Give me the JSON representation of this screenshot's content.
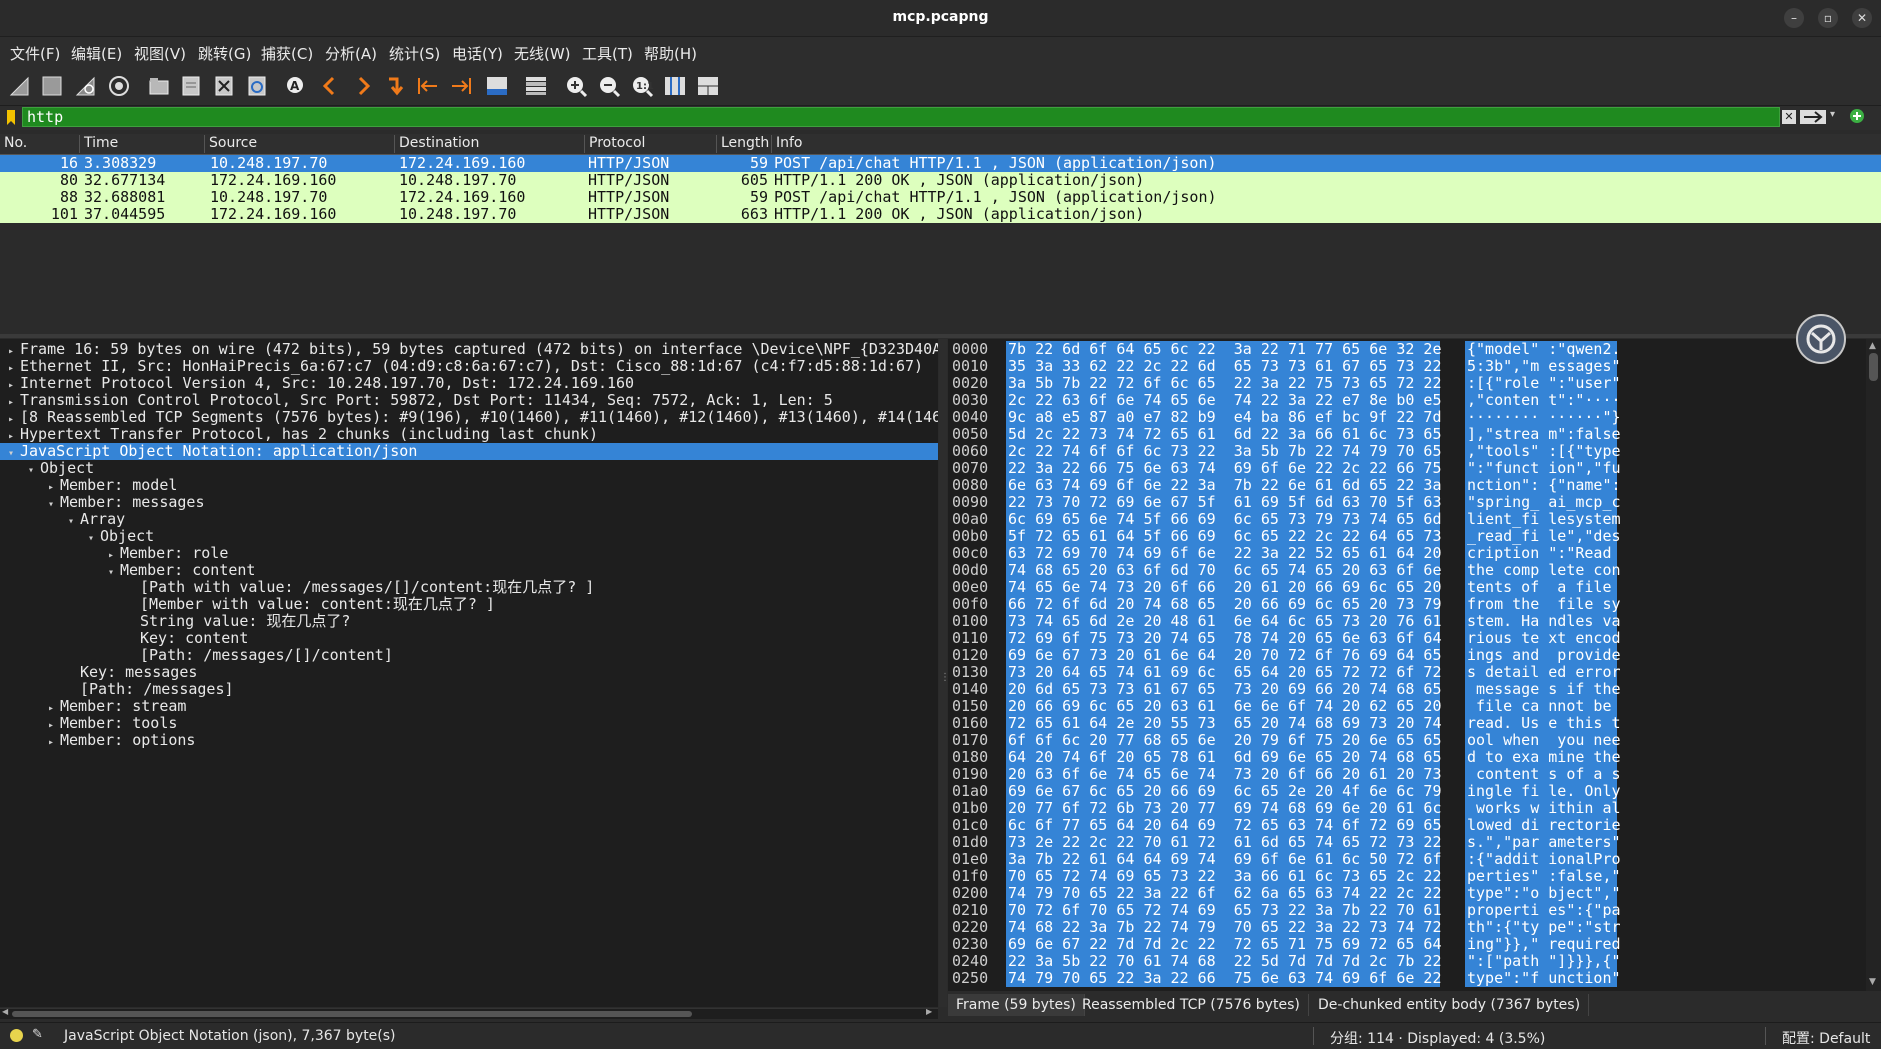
{
  "window": {
    "title": "mcp.pcapng"
  },
  "menu": [
    "文件(F)",
    "编辑(E)",
    "视图(V)",
    "跳转(G)",
    "捕获(C)",
    "分析(A)",
    "统计(S)",
    "电话(Y)",
    "无线(W)",
    "工具(T)",
    "帮助(H)"
  ],
  "filter": {
    "value": "http"
  },
  "columns": [
    "No.",
    "Time",
    "Source",
    "Destination",
    "Protocol",
    "Length",
    "Info"
  ],
  "packets": [
    {
      "no": "16",
      "time": "3.308329",
      "src": "10.248.197.70",
      "dst": "172.24.169.160",
      "proto": "HTTP/JSON",
      "len": "59",
      "info": "POST /api/chat HTTP/1.1 , JSON (application/json)"
    },
    {
      "no": "80",
      "time": "32.677134",
      "src": "172.24.169.160",
      "dst": "10.248.197.70",
      "proto": "HTTP/JSON",
      "len": "605",
      "info": "HTTP/1.1 200 OK , JSON (application/json)"
    },
    {
      "no": "88",
      "time": "32.688081",
      "src": "10.248.197.70",
      "dst": "172.24.169.160",
      "proto": "HTTP/JSON",
      "len": "59",
      "info": "POST /api/chat HTTP/1.1 , JSON (application/json)"
    },
    {
      "no": "101",
      "time": "37.044595",
      "src": "172.24.169.160",
      "dst": "10.248.197.70",
      "proto": "HTTP/JSON",
      "len": "663",
      "info": "HTTP/1.1 200 OK , JSON (application/json)"
    }
  ],
  "details": [
    {
      "indent": 0,
      "arrow": "right",
      "text": "Frame 16: 59 bytes on wire (472 bits), 59 bytes captured (472 bits) on interface \\Device\\NPF_{D323D40A"
    },
    {
      "indent": 0,
      "arrow": "right",
      "text": "Ethernet II, Src: HonHaiPrecis_6a:67:c7 (04:d9:c8:6a:67:c7), Dst: Cisco_88:1d:67 (c4:f7:d5:88:1d:67)"
    },
    {
      "indent": 0,
      "arrow": "right",
      "text": "Internet Protocol Version 4, Src: 10.248.197.70, Dst: 172.24.169.160"
    },
    {
      "indent": 0,
      "arrow": "right",
      "text": "Transmission Control Protocol, Src Port: 59872, Dst Port: 11434, Seq: 7572, Ack: 1, Len: 5"
    },
    {
      "indent": 0,
      "arrow": "right",
      "text": "[8 Reassembled TCP Segments (7576 bytes): #9(196), #10(1460), #11(1460), #12(1460), #13(1460), #14(146"
    },
    {
      "indent": 0,
      "arrow": "right",
      "text": "Hypertext Transfer Protocol, has 2 chunks (including last chunk)"
    },
    {
      "indent": 0,
      "arrow": "down",
      "text": "JavaScript Object Notation: application/json"
    },
    {
      "indent": 1,
      "arrow": "down",
      "text": "Object"
    },
    {
      "indent": 2,
      "arrow": "right",
      "text": "Member: model"
    },
    {
      "indent": 2,
      "arrow": "down",
      "text": "Member: messages"
    },
    {
      "indent": 3,
      "arrow": "down",
      "text": "Array"
    },
    {
      "indent": 4,
      "arrow": "down",
      "text": "Object"
    },
    {
      "indent": 5,
      "arrow": "right",
      "text": "Member: role"
    },
    {
      "indent": 5,
      "arrow": "down",
      "text": "Member: content"
    },
    {
      "indent": 6,
      "arrow": "none",
      "text": "[Path with value: /messages/[]/content:现在几点了? ]"
    },
    {
      "indent": 6,
      "arrow": "none",
      "text": "[Member with value: content:现在几点了? ]"
    },
    {
      "indent": 6,
      "arrow": "none",
      "text": "String value: 现在几点了?"
    },
    {
      "indent": 6,
      "arrow": "none",
      "text": "Key: content"
    },
    {
      "indent": 6,
      "arrow": "none",
      "text": "[Path: /messages/[]/content]"
    },
    {
      "indent": 3,
      "arrow": "none",
      "text": "Key: messages"
    },
    {
      "indent": 3,
      "arrow": "none",
      "text": "[Path: /messages]"
    },
    {
      "indent": 2,
      "arrow": "right",
      "text": "Member: stream"
    },
    {
      "indent": 2,
      "arrow": "right",
      "text": "Member: tools"
    },
    {
      "indent": 2,
      "arrow": "right",
      "text": "Member: options"
    }
  ],
  "bytes": [
    {
      "off": "0000",
      "hex": "7b 22 6d 6f 64 65 6c 22  3a 22 71 77 65 6e 32 2e",
      "ascii": "{\"model\" :\"qwen2."
    },
    {
      "off": "0010",
      "hex": "35 3a 33 62 22 2c 22 6d  65 73 73 61 67 65 73 22",
      "ascii": "5:3b\",\"m essages\""
    },
    {
      "off": "0020",
      "hex": "3a 5b 7b 22 72 6f 6c 65  22 3a 22 75 73 65 72 22",
      "ascii": ":[{\"role \":\"user\""
    },
    {
      "off": "0030",
      "hex": "2c 22 63 6f 6e 74 65 6e  74 22 3a 22 e7 8e b0 e5",
      "ascii": ",\"conten t\":\"····"
    },
    {
      "off": "0040",
      "hex": "9c a8 e5 87 a0 e7 82 b9  e4 ba 86 ef bc 9f 22 7d",
      "ascii": "········ ······\"}"
    },
    {
      "off": "0050",
      "hex": "5d 2c 22 73 74 72 65 61  6d 22 3a 66 61 6c 73 65",
      "ascii": "],\"strea m\":false"
    },
    {
      "off": "0060",
      "hex": "2c 22 74 6f 6f 6c 73 22  3a 5b 7b 22 74 79 70 65",
      "ascii": ",\"tools\" :[{\"type"
    },
    {
      "off": "0070",
      "hex": "22 3a 22 66 75 6e 63 74  69 6f 6e 22 2c 22 66 75",
      "ascii": "\":\"funct ion\",\"fu"
    },
    {
      "off": "0080",
      "hex": "6e 63 74 69 6f 6e 22 3a  7b 22 6e 61 6d 65 22 3a",
      "ascii": "nction\": {\"name\":"
    },
    {
      "off": "0090",
      "hex": "22 73 70 72 69 6e 67 5f  61 69 5f 6d 63 70 5f 63",
      "ascii": "\"spring_ ai_mcp_c"
    },
    {
      "off": "00a0",
      "hex": "6c 69 65 6e 74 5f 66 69  6c 65 73 79 73 74 65 6d",
      "ascii": "lient_fi lesystem"
    },
    {
      "off": "00b0",
      "hex": "5f 72 65 61 64 5f 66 69  6c 65 22 2c 22 64 65 73",
      "ascii": "_read_fi le\",\"des"
    },
    {
      "off": "00c0",
      "hex": "63 72 69 70 74 69 6f 6e  22 3a 22 52 65 61 64 20",
      "ascii": "cription \":\"Read "
    },
    {
      "off": "00d0",
      "hex": "74 68 65 20 63 6f 6d 70  6c 65 74 65 20 63 6f 6e",
      "ascii": "the comp lete con"
    },
    {
      "off": "00e0",
      "hex": "74 65 6e 74 73 20 6f 66  20 61 20 66 69 6c 65 20",
      "ascii": "tents of  a file "
    },
    {
      "off": "00f0",
      "hex": "66 72 6f 6d 20 74 68 65  20 66 69 6c 65 20 73 79",
      "ascii": "from the  file sy"
    },
    {
      "off": "0100",
      "hex": "73 74 65 6d 2e 20 48 61  6e 64 6c 65 73 20 76 61",
      "ascii": "stem. Ha ndles va"
    },
    {
      "off": "0110",
      "hex": "72 69 6f 75 73 20 74 65  78 74 20 65 6e 63 6f 64",
      "ascii": "rious te xt encod"
    },
    {
      "off": "0120",
      "hex": "69 6e 67 73 20 61 6e 64  20 70 72 6f 76 69 64 65",
      "ascii": "ings and  provide"
    },
    {
      "off": "0130",
      "hex": "73 20 64 65 74 61 69 6c  65 64 20 65 72 72 6f 72",
      "ascii": "s detail ed error"
    },
    {
      "off": "0140",
      "hex": "20 6d 65 73 73 61 67 65  73 20 69 66 20 74 68 65",
      "ascii": " message s if the"
    },
    {
      "off": "0150",
      "hex": "20 66 69 6c 65 20 63 61  6e 6e 6f 74 20 62 65 20",
      "ascii": " file ca nnot be "
    },
    {
      "off": "0160",
      "hex": "72 65 61 64 2e 20 55 73  65 20 74 68 69 73 20 74",
      "ascii": "read. Us e this t"
    },
    {
      "off": "0170",
      "hex": "6f 6f 6c 20 77 68 65 6e  20 79 6f 75 20 6e 65 65",
      "ascii": "ool when  you nee"
    },
    {
      "off": "0180",
      "hex": "64 20 74 6f 20 65 78 61  6d 69 6e 65 20 74 68 65",
      "ascii": "d to exa mine the"
    },
    {
      "off": "0190",
      "hex": "20 63 6f 6e 74 65 6e 74  73 20 6f 66 20 61 20 73",
      "ascii": " content s of a s"
    },
    {
      "off": "01a0",
      "hex": "69 6e 67 6c 65 20 66 69  6c 65 2e 20 4f 6e 6c 79",
      "ascii": "ingle fi le. Only"
    },
    {
      "off": "01b0",
      "hex": "20 77 6f 72 6b 73 20 77  69 74 68 69 6e 20 61 6c",
      "ascii": " works w ithin al"
    },
    {
      "off": "01c0",
      "hex": "6c 6f 77 65 64 20 64 69  72 65 63 74 6f 72 69 65",
      "ascii": "lowed di rectorie"
    },
    {
      "off": "01d0",
      "hex": "73 2e 22 2c 22 70 61 72  61 6d 65 74 65 72 73 22",
      "ascii": "s.\",\"par ameters\""
    },
    {
      "off": "01e0",
      "hex": "3a 7b 22 61 64 64 69 74  69 6f 6e 61 6c 50 72 6f",
      "ascii": ":{\"addit ionalPro"
    },
    {
      "off": "01f0",
      "hex": "70 65 72 74 69 65 73 22  3a 66 61 6c 73 65 2c 22",
      "ascii": "perties\" :false,\""
    },
    {
      "off": "0200",
      "hex": "74 79 70 65 22 3a 22 6f  62 6a 65 63 74 22 2c 22",
      "ascii": "type\":\"o bject\",\""
    },
    {
      "off": "0210",
      "hex": "70 72 6f 70 65 72 74 69  65 73 22 3a 7b 22 70 61",
      "ascii": "properti es\":{\"pa"
    },
    {
      "off": "0220",
      "hex": "74 68 22 3a 7b 22 74 79  70 65 22 3a 22 73 74 72",
      "ascii": "th\":{\"ty pe\":\"str"
    },
    {
      "off": "0230",
      "hex": "69 6e 67 22 7d 7d 2c 22  72 65 71 75 69 72 65 64",
      "ascii": "ing\"}},\" required"
    },
    {
      "off": "0240",
      "hex": "22 3a 5b 22 70 61 74 68  22 5d 7d 7d 7d 2c 7b 22",
      "ascii": "\":[\"path \"]}}},{\""
    },
    {
      "off": "0250",
      "hex": "74 79 70 65 22 3a 22 66  75 6e 63 74 69 6f 6e 22",
      "ascii": "type\":\"f unction\""
    }
  ],
  "bytes_tabs": [
    "Frame (59 bytes)",
    "Reassembled TCP (7576 bytes)",
    "De-chunked entity body (7367 bytes)"
  ],
  "status": {
    "field": "JavaScript Object Notation (json), 7,367 byte(s)",
    "packets": "分组: 114 · Displayed: 4 (3.5%)",
    "profile": "配置: Default"
  },
  "colors": {
    "accent": "#3584d6",
    "filter_ok": "#1f8a1f",
    "packet_row": "#ddffbe"
  },
  "icons": {
    "toolbar": [
      "shark-fin-start-icon",
      "stop-square-icon",
      "shark-fin-restart-icon",
      "gear-options-icon",
      "folder-open-icon",
      "file-save-icon",
      "close-file-icon",
      "reload-icon",
      "find-packet-icon",
      "go-back-icon",
      "go-forward-icon",
      "jump-to-packet-icon",
      "first-packet-icon",
      "last-packet-icon",
      "autoscroll-icon",
      "colorize-icon",
      "zoom-in-icon",
      "zoom-out-icon",
      "zoom-normal-icon",
      "resize-columns-icon",
      "layout-icon"
    ]
  }
}
